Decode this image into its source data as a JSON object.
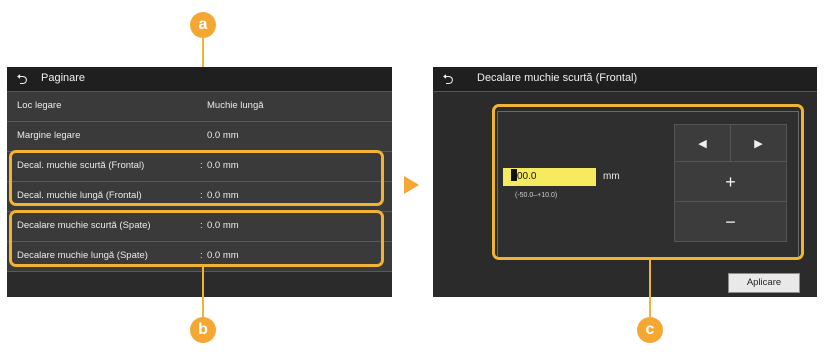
{
  "left_screen": {
    "title": "Paginare",
    "rows": [
      {
        "label": "Loc legare",
        "value": "Muchie lungă",
        "colon": ""
      },
      {
        "label": "Margine legare",
        "value": "0.0 mm",
        "colon": ""
      },
      {
        "label": "Decal. muchie scurtă (Frontal)",
        "value": "0.0 mm",
        "colon": ":"
      },
      {
        "label": "Decal. muchie lungă (Frontal)",
        "value": "0.0 mm",
        "colon": ":"
      },
      {
        "label": "Decalare muchie scurtă (Spate)",
        "value": "0.0 mm",
        "colon": ":"
      },
      {
        "label": "Decalare muchie lungă (Spate)",
        "value": "0.0 mm",
        "colon": ":"
      }
    ]
  },
  "right_screen": {
    "title": "Decalare muchie scurtă (Frontal)",
    "value": "00.0",
    "unit": "mm",
    "range": "(-50.0–+10.0)",
    "keys": {
      "left": "◀",
      "right": "▶",
      "plus": "+",
      "minus": "−"
    },
    "apply_label": "Aplicare"
  },
  "callouts": {
    "a": "a",
    "b": "b",
    "c": "c"
  },
  "colors": {
    "accent": "#f4a733",
    "screen_bg": "#2b2b2b",
    "input_bg": "#f6ea5e"
  }
}
